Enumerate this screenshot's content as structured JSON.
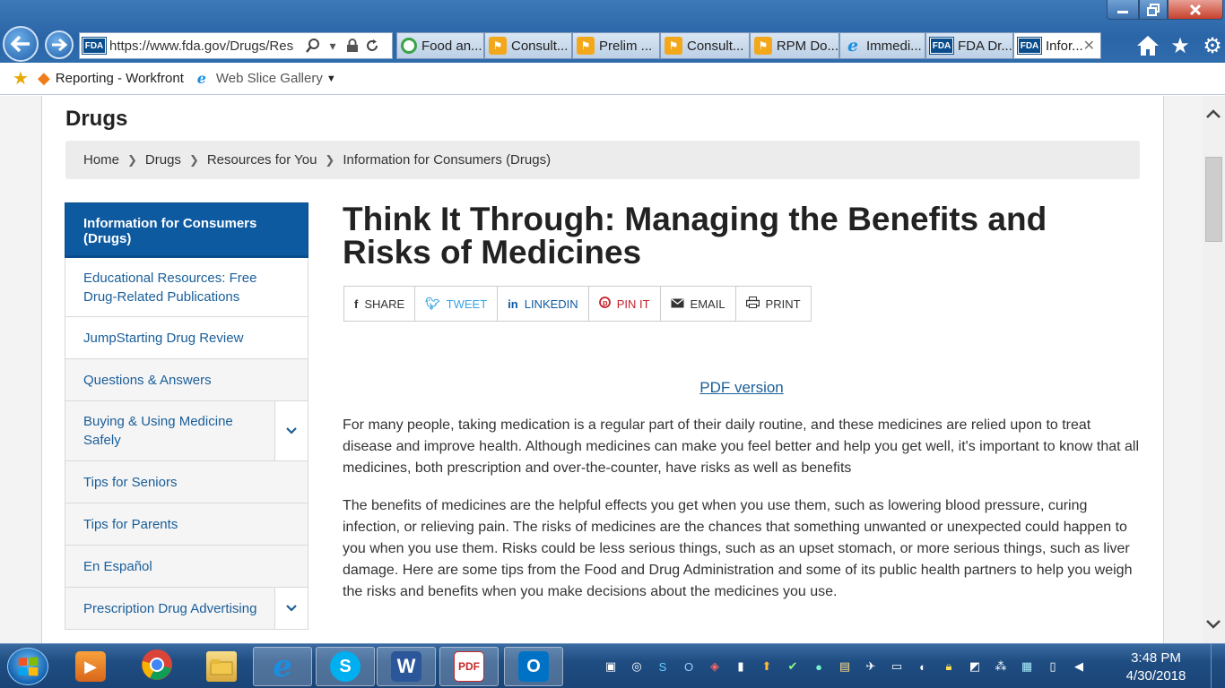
{
  "browser": {
    "url": "https://www.fda.gov/Drugs/Res",
    "tabs": [
      {
        "label": "Food an...",
        "icon": "green-circle-favicon",
        "active": false
      },
      {
        "label": "Consult...",
        "icon": "orange-favicon",
        "active": false
      },
      {
        "label": "Prelim ...",
        "icon": "orange-favicon",
        "active": false
      },
      {
        "label": "Consult...",
        "icon": "orange-favicon",
        "active": false
      },
      {
        "label": "RPM Do...",
        "icon": "orange-favicon",
        "active": false
      },
      {
        "label": "Immedi...",
        "icon": "ie-favicon",
        "active": false
      },
      {
        "label": "FDA Dr...",
        "icon": "fda-favicon",
        "active": false
      },
      {
        "label": "Infor...",
        "icon": "fda-favicon",
        "active": true
      }
    ],
    "favicon_text": "FDA",
    "favorites": [
      {
        "label": "Reporting - Workfront",
        "icon": "workfront-icon"
      },
      {
        "label": "Web Slice Gallery",
        "icon": "ie-icon"
      }
    ]
  },
  "page": {
    "section_title": "Drugs",
    "breadcrumb": [
      "Home",
      "Drugs",
      "Resources for You",
      "Information for Consumers (Drugs)"
    ],
    "sidenav": {
      "heading": "Information for Consumers (Drugs)",
      "items": [
        {
          "label": "Educational Resources: Free Drug-Related Publications",
          "expandable": false
        },
        {
          "label": "JumpStarting Drug Review",
          "expandable": false
        },
        {
          "label": "Questions & Answers",
          "expandable": false
        },
        {
          "label": "Buying & Using Medicine Safely",
          "expandable": true
        },
        {
          "label": "Tips for Seniors",
          "expandable": false
        },
        {
          "label": "Tips for Parents",
          "expandable": false
        },
        {
          "label": "En Español",
          "expandable": false
        },
        {
          "label": "Prescription Drug Advertising",
          "expandable": true
        }
      ]
    },
    "article": {
      "title": "Think It Through: Managing the Benefits and Risks of Medicines",
      "share": {
        "share": "SHARE",
        "tweet": "TWEET",
        "linkedin": "LINKEDIN",
        "pinit": "PIN IT",
        "email": "EMAIL",
        "print": "PRINT"
      },
      "pdf_link": "PDF version",
      "paragraphs": [
        "For many people, taking medication is a regular part of their daily routine, and these medicines are relied upon to treat disease and improve health.  Although medicines can make you feel better and help you get well, it's important to know that all medicines, both prescription and over-the-counter, have risks as well as benefits",
        "The benefits of medicines are the helpful effects you get when you use them, such as lowering blood pressure, curing infection, or relieving pain. The risks of medicines are the chances that something unwanted or unexpected could happen to you when you use them. Risks could be less serious things, such as an upset stomach, or more serious things, such as liver damage. Here are some tips from the Food and Drug Administration and some of its public health partners to help you weigh the risks and benefits when you make decisions about the medicines you use."
      ]
    }
  },
  "taskbar": {
    "apps": [
      "media-player-icon",
      "chrome-icon",
      "file-explorer-icon",
      "internet-explorer-icon",
      "skype-icon",
      "word-icon",
      "pdf-reader-icon",
      "outlook-icon"
    ],
    "time": "3:48 PM",
    "date": "4/30/2018"
  },
  "colors": {
    "fda_blue": "#0e5aa0",
    "link_blue": "#1a5e99",
    "twitter": "#3aa5e0",
    "pinterest": "#c71f29"
  }
}
